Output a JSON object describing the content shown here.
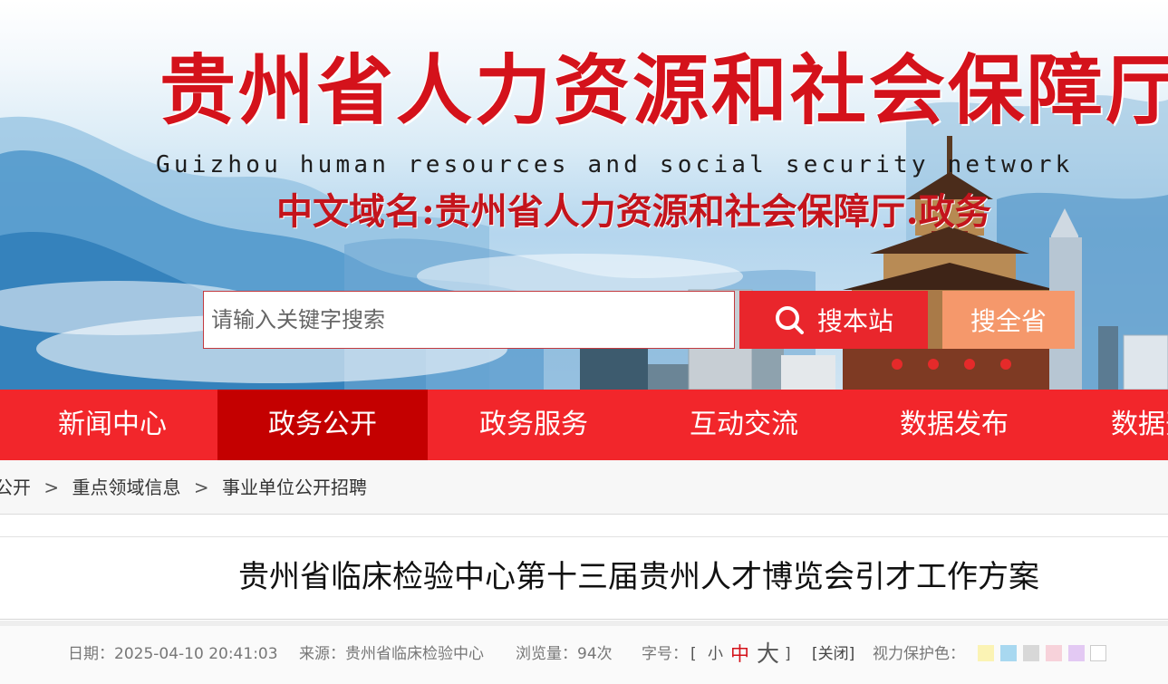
{
  "header": {
    "title": "贵州省人力资源和社会保障厅",
    "subtitle": "Guizhou human resources and social security network",
    "domain": "中文域名:贵州省人力资源和社会保障厅.政务"
  },
  "search": {
    "placeholder": "请输入关键字搜索",
    "site_button": "搜本站",
    "province_button": "搜全省",
    "site_icon": "search-icon"
  },
  "nav": {
    "active_index": 1,
    "items": [
      "新闻中心",
      "政务公开",
      "政务服务",
      "互动交流",
      "数据发布",
      "数据开放"
    ]
  },
  "breadcrumb": {
    "items": [
      "公开",
      "重点领域信息",
      "事业单位公开招聘"
    ],
    "separator": ">"
  },
  "article": {
    "title": "贵州省临床检验中心第十三届贵州人才博览会引才工作方案",
    "date_label": "日期：",
    "date_value": "2025-04-10 20:41:03",
    "source_label": "来源：",
    "source_value": "贵州省临床检验中心",
    "views_label": "浏览量：",
    "views_value": "94次",
    "font_label": "字号：",
    "font_open": "[",
    "font_small": "小",
    "font_medium": "中",
    "font_large": "大",
    "font_close": "]",
    "close_link": "[关闭]",
    "eye_label": "视力保护色："
  },
  "colors": {
    "brand_red": "#f2262b",
    "nav_active": "#c40000",
    "search_site": "#e9262c",
    "search_province": "#f5986b",
    "eye_swatches": [
      "#fbf3b4",
      "#a8d8f0",
      "#d8d8d8",
      "#f7d2da",
      "#e3c9f3",
      "#ffffff"
    ]
  }
}
